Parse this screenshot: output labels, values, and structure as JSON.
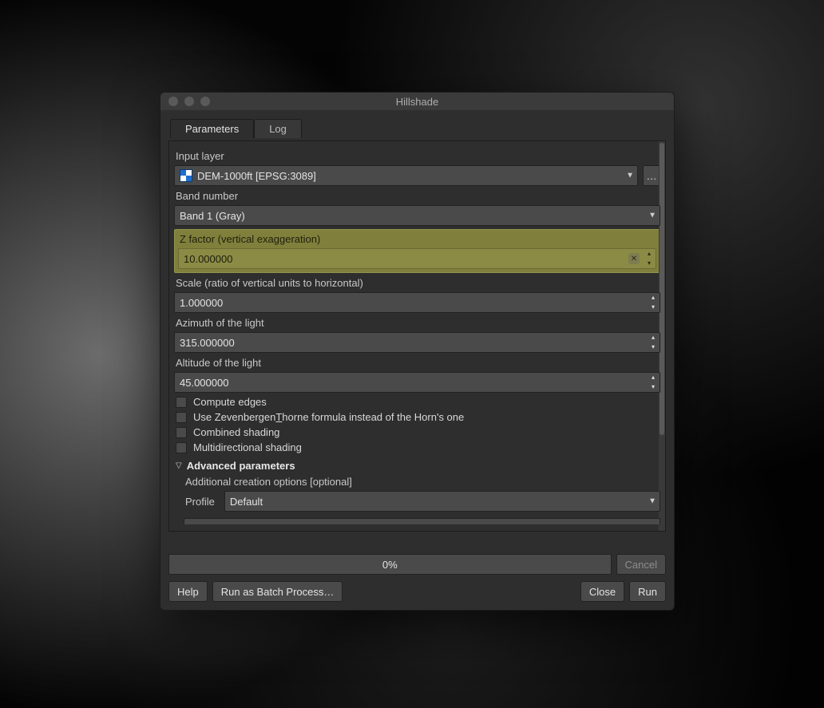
{
  "window": {
    "title": "Hillshade"
  },
  "tabs": {
    "parameters": "Parameters",
    "log": "Log"
  },
  "labels": {
    "input_layer": "Input layer",
    "band_number": "Band number",
    "z_factor": "Z factor (vertical exaggeration)",
    "scale": "Scale (ratio of vertical units to horizontal)",
    "azimuth": "Azimuth of the light",
    "altitude": "Altitude of the light",
    "advanced": "Advanced parameters",
    "additional": "Additional creation options [optional]",
    "profile": "Profile"
  },
  "values": {
    "input_layer": "DEM-1000ft [EPSG:3089]",
    "band_number": "Band 1 (Gray)",
    "z_factor": "10.000000",
    "scale": "1.000000",
    "azimuth": "315.000000",
    "altitude": "45.000000",
    "profile": "Default"
  },
  "checks": {
    "compute_edges": "Compute edges",
    "zeven_pre": "Use Zevenbergen",
    "zeven_u": "T",
    "zeven_post": "horne formula instead of the Horn's one",
    "combined": "Combined shading",
    "multidir": "Multidirectional shading"
  },
  "progress": {
    "text": "0%"
  },
  "buttons": {
    "cancel": "Cancel",
    "help": "Help",
    "batch": "Run as Batch Process…",
    "close": "Close",
    "run": "Run",
    "browse": "…"
  }
}
